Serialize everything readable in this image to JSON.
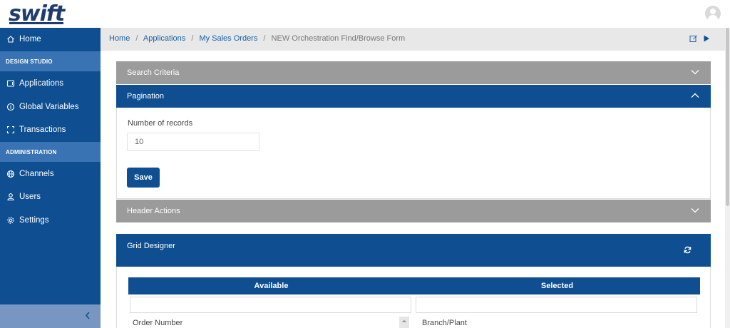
{
  "app": {
    "logo_text": "swift"
  },
  "sidebar": {
    "items": [
      {
        "label": "Home",
        "icon": "home-icon"
      },
      {
        "label": "Applications",
        "icon": "tablet-icon"
      },
      {
        "label": "Global Variables",
        "icon": "info-icon"
      },
      {
        "label": "Transactions",
        "icon": "expand-icon"
      },
      {
        "label": "Channels",
        "icon": "globe-icon"
      },
      {
        "label": "Users",
        "icon": "user-icon"
      },
      {
        "label": "Settings",
        "icon": "gear-icon"
      }
    ],
    "sections": [
      "DESIGN STUDIO",
      "ADMINISTRATION"
    ]
  },
  "breadcrumb": {
    "items": [
      "Home",
      "Applications",
      "My Sales Orders"
    ],
    "current": "NEW Orchestration Find/Browse Form",
    "separator": "/"
  },
  "panels": {
    "search_criteria": {
      "title": "Search Criteria",
      "state": "collapsed"
    },
    "pagination": {
      "title": "Pagination",
      "state": "expanded",
      "field_label": "Number of records",
      "field_value": "10",
      "save_label": "Save"
    },
    "header_actions": {
      "title": "Header Actions",
      "state": "collapsed"
    },
    "grid_designer": {
      "title": "Grid Designer",
      "available_header": "Available",
      "selected_header": "Selected",
      "available_items": [
        "Order Number"
      ],
      "selected_items": [
        "Branch/Plant"
      ]
    }
  },
  "colors": {
    "primary": "#0f4f91",
    "section": "#3a73b3",
    "collapsed_panel": "#9b9b9b",
    "link": "#1860a8"
  }
}
